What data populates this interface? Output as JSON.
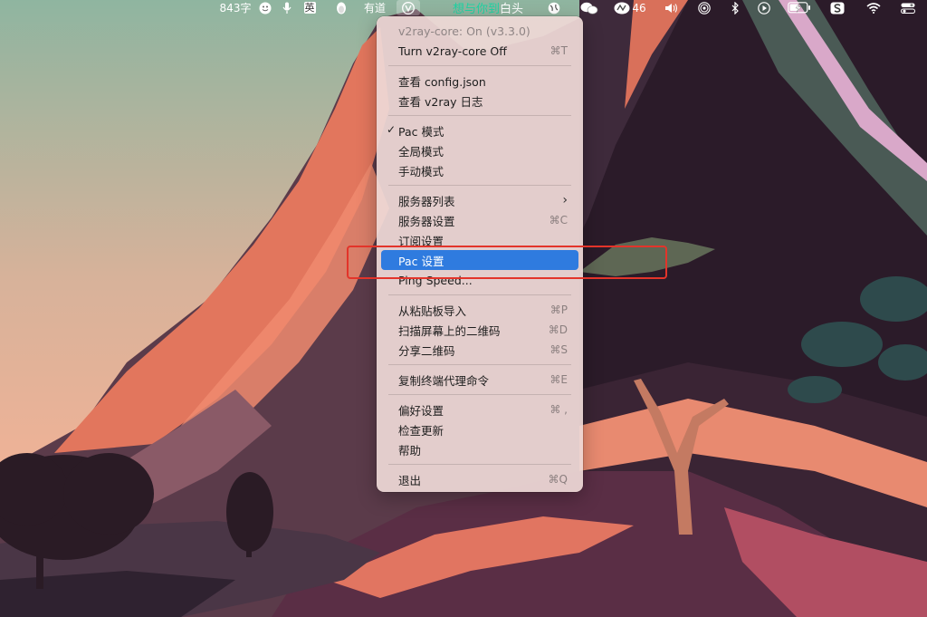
{
  "menubar": {
    "word_count": "843字",
    "emoji_icon": "smile-icon",
    "mic_icon": "mic-icon",
    "input_method": "英",
    "qq_icon": "penguin-icon",
    "youdao": "有道",
    "v2ray_icon": "v2ray-icon",
    "ticker_green": "想与你到",
    "ticker_white": "白头",
    "battery_percent": "46"
  },
  "menu": {
    "status": "v2ray-core: On  (v3.3.0)",
    "toggle_core": {
      "label": "Turn v2ray-core Off",
      "shortcut": "⌘T"
    },
    "view_config": "查看 config.json",
    "view_log": "查看 v2ray 日志",
    "mode_pac": "Pac 模式",
    "mode_global": "全局模式",
    "mode_manual": "手动模式",
    "server_list": "服务器列表",
    "server_settings": {
      "label": "服务器设置",
      "shortcut": "⌘C"
    },
    "subscription": "订阅设置",
    "pac_settings": "Pac 设置",
    "ping_speed": "Ping Speed...",
    "import_clipboard": {
      "label": "从粘贴板导入",
      "shortcut": "⌘P"
    },
    "scan_qr": {
      "label": "扫描屏幕上的二维码",
      "shortcut": "⌘D"
    },
    "share_qr": {
      "label": "分享二维码",
      "shortcut": "⌘S"
    },
    "copy_proxy_cmd": {
      "label": "复制终端代理命令",
      "shortcut": "⌘E"
    },
    "preferences": {
      "label": "偏好设置",
      "shortcut": "⌘ ,"
    },
    "check_updates": "检查更新",
    "help": "帮助",
    "quit": {
      "label": "退出",
      "shortcut": "⌘Q"
    }
  },
  "colors": {
    "highlight": "#2f7bdf",
    "annotation_box": "#e3342a",
    "ticker_green": "#1fd3a3"
  }
}
